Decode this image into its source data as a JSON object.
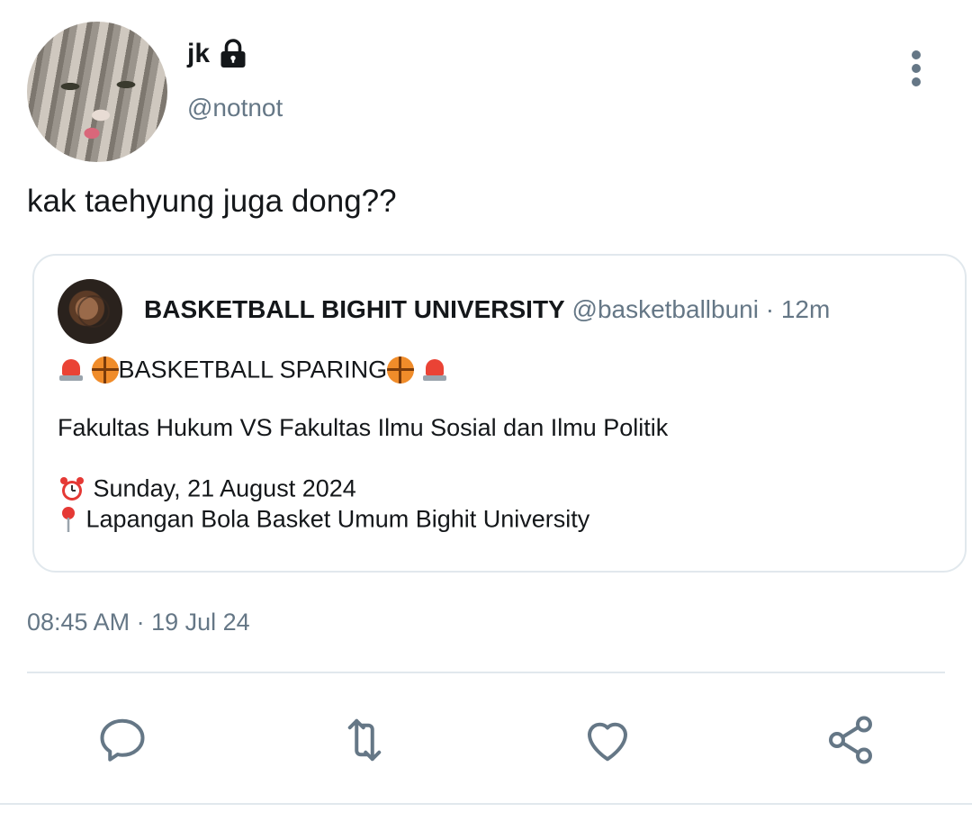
{
  "author": {
    "display_name": "jk",
    "handle": "@notnot",
    "protected_icon": "lock-icon"
  },
  "tweet": {
    "text": "kak taehyung juga dong??",
    "timestamp": "08:45 AM · 19 Jul 24"
  },
  "quoted": {
    "name": "BASKETBALL BIGHIT UNIVERSITY",
    "handle": "@basketballbuni",
    "separator": "·",
    "time": "12m",
    "title": "BASKETBALL SPARING",
    "match": "Fakultas Hukum VS Fakultas Ilmu Sosial dan Ilmu Politik",
    "date": "Sunday, 21 August 2024",
    "location": "Lapangan Bola Basket Umum Bighit University"
  },
  "actions": [
    {
      "icon": "reply-icon"
    },
    {
      "icon": "retweet-icon"
    },
    {
      "icon": "like-icon"
    },
    {
      "icon": "share-icon"
    }
  ],
  "colors": {
    "text": "#14171a",
    "secondary": "#657786",
    "border": "#e1e8ed"
  }
}
